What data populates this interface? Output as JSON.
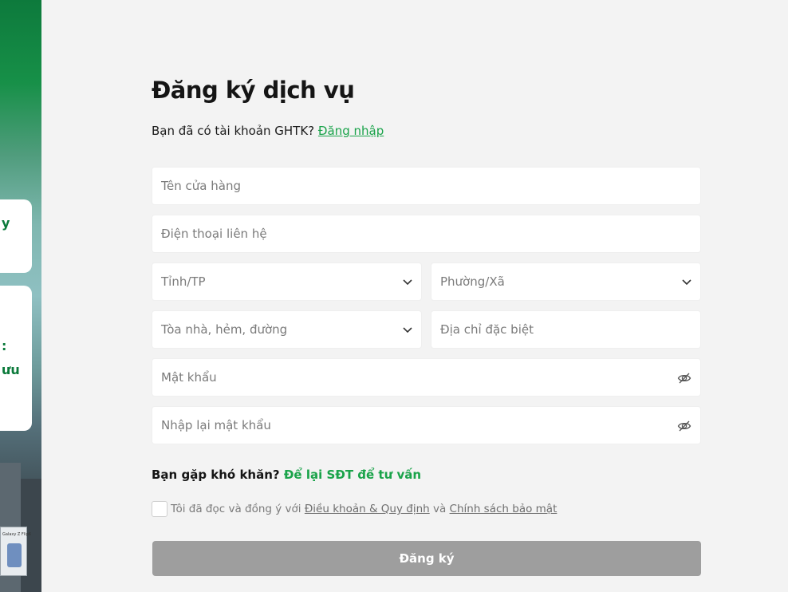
{
  "left_panel": {
    "card1_text": "y",
    "card2_line1": ":",
    "card2_line2": "ưu",
    "billboard_text": "Galaxy Z Flip6"
  },
  "form": {
    "title": "Đăng ký dịch vụ",
    "subtitle_prefix": "Bạn đã có tài khoản GHTK?",
    "login_link": "Đăng nhập",
    "store_name_placeholder": "Tên cửa hàng",
    "phone_placeholder": "Điện thoại liên hệ",
    "province_placeholder": "Tỉnh/TP",
    "ward_placeholder": "Phường/Xã",
    "street_placeholder": "Tòa nhà, hẻm, đường",
    "special_address_placeholder": "Địa chỉ đặc biệt",
    "password_placeholder": "Mật khẩu",
    "confirm_password_placeholder": "Nhập lại mật khẩu",
    "help_prefix": "Bạn gặp khó khăn?",
    "help_link": "Để lại SĐT để tư vấn",
    "agree_prefix": "Tôi đã đọc và đồng ý với",
    "terms_link": "Điều khoản & Quy định",
    "agree_and": "và",
    "privacy_link": "Chính sách bảo mật",
    "submit_label": "Đăng ký"
  },
  "colors": {
    "brand_green": "#1aa34a",
    "submit_disabled": "#9e9e9e",
    "background": "#f3f3f3"
  }
}
